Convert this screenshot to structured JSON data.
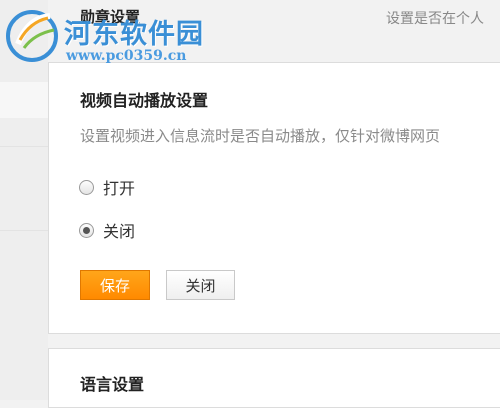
{
  "watermark": {
    "site_name": "河东软件园",
    "site_url": "www.pc0359.cn"
  },
  "badge_section": {
    "title": "勋章设置",
    "description": "设置是否在个人"
  },
  "video_autoplay": {
    "title": "视频自动播放设置",
    "description": "设置视频进入信息流时是否自动播放，仅针对微博网页",
    "options": [
      {
        "label": "打开",
        "checked": false
      },
      {
        "label": "关闭",
        "checked": true
      }
    ],
    "save_label": "保存",
    "close_label": "关闭"
  },
  "language_section": {
    "title": "语言设置"
  },
  "colors": {
    "accent": "#ff8a00",
    "watermark": "#3a8fd6"
  }
}
